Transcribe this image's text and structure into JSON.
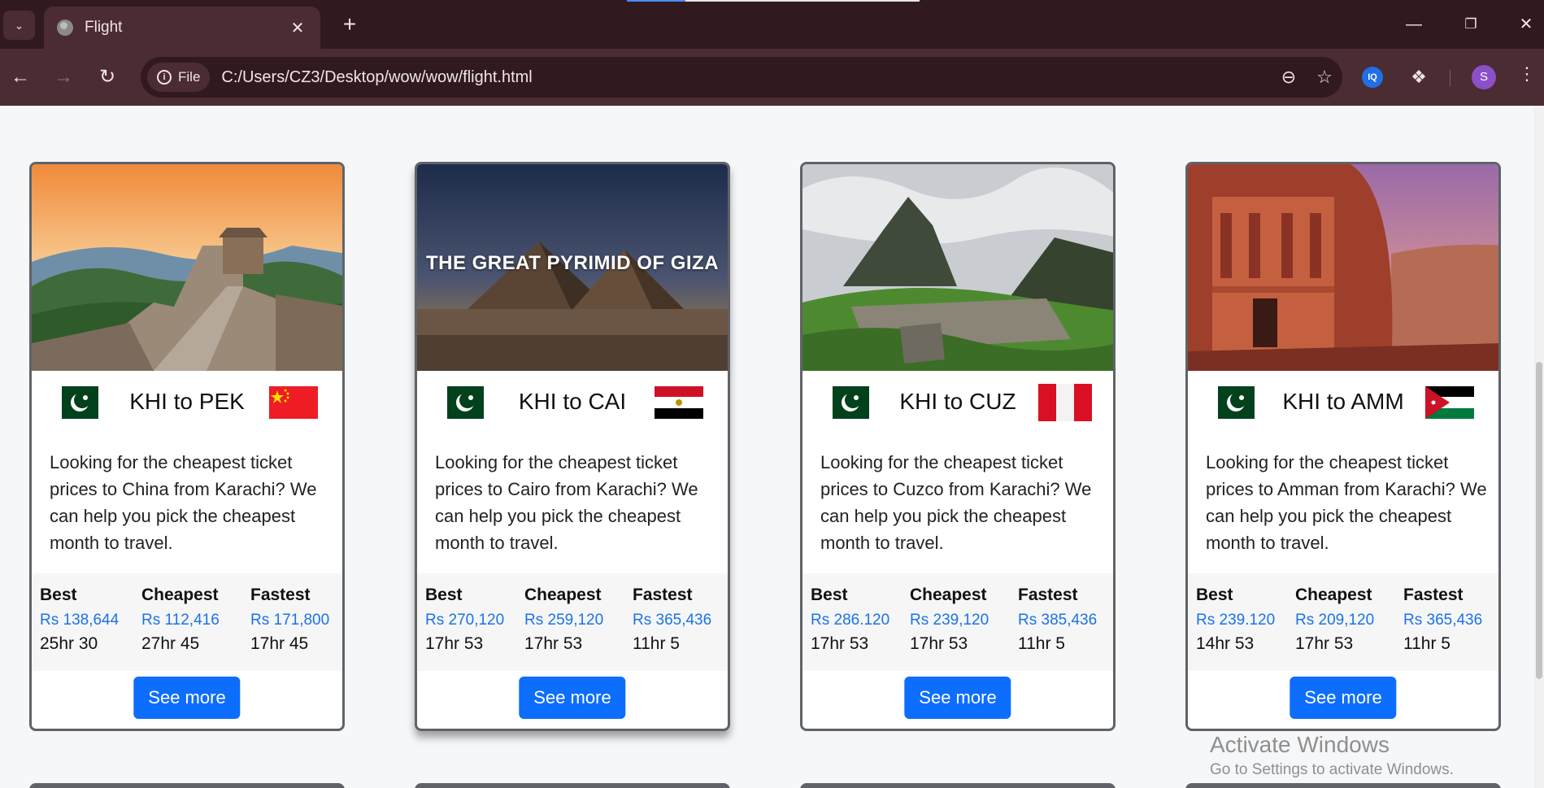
{
  "browser": {
    "tab_title": "Flight",
    "url": "C:/Users/CZ3/Desktop/wow/wow/flight.html",
    "protocol_chip": "File",
    "avatar_letter": "S",
    "extension_label": "IQ"
  },
  "cards": [
    {
      "image_label": "",
      "route": "KHI to PEK",
      "description": "Looking for the cheapest ticket prices to China from Karachi? We can help you pick the cheapest month to travel.",
      "best_label": "Best",
      "best_price": "Rs 138,644",
      "best_time": "25hr 30",
      "cheapest_label": "Cheapest",
      "cheapest_price": "Rs 112,416",
      "cheapest_time": "27hr 45",
      "fastest_label": "Fastest",
      "fastest_price": "Rs 171,800",
      "fastest_time": "17hr 45",
      "button": "See more"
    },
    {
      "image_label": "THE GREAT PYRIMID OF GIZA",
      "route": "KHI to CAI",
      "description": "Looking for the cheapest ticket prices to Cairo from Karachi? We can help you pick the cheapest month to travel.",
      "best_label": "Best",
      "best_price": "Rs 270,120",
      "best_time": "17hr 53",
      "cheapest_label": "Cheapest",
      "cheapest_price": "Rs 259,120",
      "cheapest_time": "17hr 53",
      "fastest_label": "Fastest",
      "fastest_price": "Rs 365,436",
      "fastest_time": "11hr 5",
      "button": "See more"
    },
    {
      "image_label": "",
      "route": "KHI to CUZ",
      "description": "Looking for the cheapest ticket prices to Cuzco from Karachi? We can help you pick the cheapest month to travel.",
      "best_label": "Best",
      "best_price": "Rs 286.120",
      "best_time": "17hr 53",
      "cheapest_label": "Cheapest",
      "cheapest_price": "Rs 239,120",
      "cheapest_time": "17hr 53",
      "fastest_label": "Fastest",
      "fastest_price": "Rs 385,436",
      "fastest_time": "11hr 5",
      "button": "See more"
    },
    {
      "image_label": "",
      "route": "KHI to AMM",
      "description": "Looking for the cheapest ticket prices to Amman from Karachi? We can help you pick the cheapest month to travel.",
      "best_label": "Best",
      "best_price": "Rs 239.120",
      "best_time": "14hr 53",
      "cheapest_label": "Cheapest",
      "cheapest_price": "Rs 209,120",
      "cheapest_time": "17hr 53",
      "fastest_label": "Fastest",
      "fastest_price": "Rs 365,436",
      "fastest_time": "11hr 5",
      "button": "See more"
    }
  ],
  "watermark": {
    "line1": "Activate Windows",
    "line2": "Go to Settings to activate Windows."
  }
}
